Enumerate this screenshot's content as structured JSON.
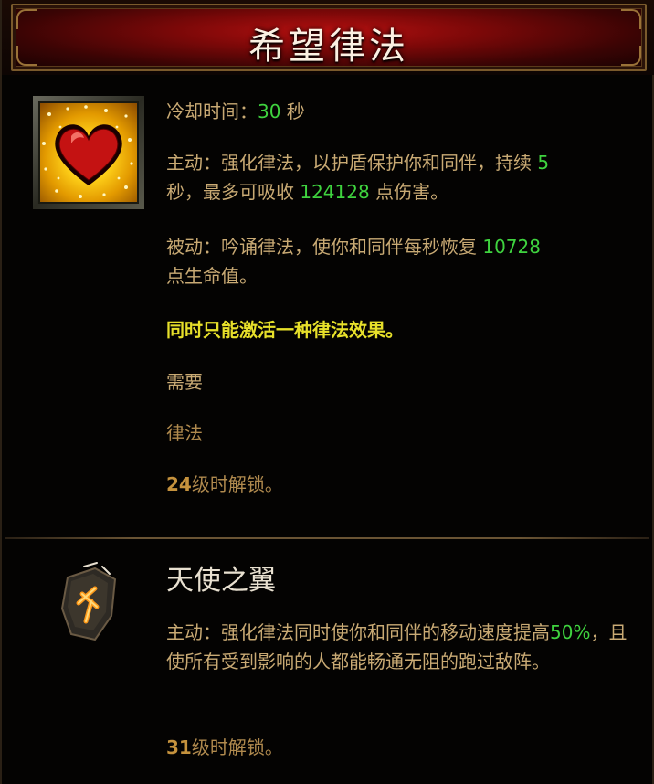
{
  "header": {
    "title": "希望律法"
  },
  "skill": {
    "icon": "heart-shield-icon",
    "cooldown_label": "冷却时间：",
    "cooldown_value": "30",
    "cooldown_unit": " 秒",
    "active_prefix": "主动：强化律法，以护盾保护你和同伴，持续",
    "active_duration": " 5",
    "active_mid": "秒，最多可吸收",
    "active_absorb": " 124128",
    "active_suffix": " 点伤害。",
    "passive_prefix": "被动：吟诵律法，使你和同伴每秒恢复",
    "passive_value": " 10728",
    "passive_suffix": "点生命值。",
    "note": "同时只能激活一种律法效果。",
    "requires_label": "需要",
    "requires_value": "律法",
    "unlock_level": "24",
    "unlock_suffix": "级时解锁。"
  },
  "rune": {
    "icon": "rune-stone-icon",
    "title": "天使之翼",
    "desc_prefix": "主动：强化律法同时使你和同伴的移动速度提高",
    "desc_value": "50%",
    "desc_suffix": "，且使所有受到影响的人都能畅通无阻的跑过敌阵。",
    "unlock_level": "31",
    "unlock_suffix": "级时解锁。"
  },
  "colors": {
    "stat_green": "#3fd33f",
    "note_yellow": "#e7e02a",
    "text_tan": "#c9aa74",
    "banner_red": "#b41010"
  }
}
